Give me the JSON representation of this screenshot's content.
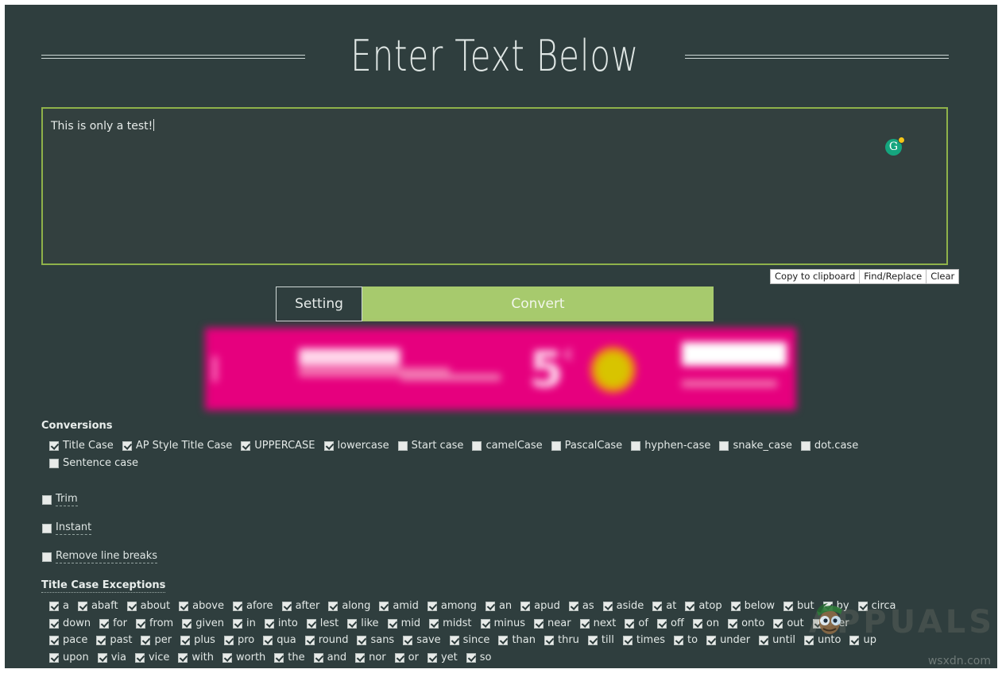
{
  "page": {
    "background_color": "#2f3e3e",
    "title": "Enter Text Below"
  },
  "editor": {
    "text": "This is only a test!",
    "grammarly_icon": "grammarly-icon",
    "grammarly_letter": "G",
    "border_color": "#8fb24a"
  },
  "editor_tools": {
    "copy_label": "Copy to clipboard",
    "find_replace_label": "Find/Replace",
    "clear_label": "Clear"
  },
  "actions": {
    "setting_label": "Setting",
    "convert_label": "Convert",
    "convert_color": "#a7ca6d"
  },
  "advert": {
    "headline_number": "5",
    "headline_sup": "€",
    "background_color": "#e6007e"
  },
  "conversions": {
    "heading": "Conversions",
    "items": [
      {
        "label": "Title Case",
        "checked": true
      },
      {
        "label": "AP Style Title Case",
        "checked": true
      },
      {
        "label": "UPPERCASE",
        "checked": true
      },
      {
        "label": "lowercase",
        "checked": true
      },
      {
        "label": "Start case",
        "checked": false
      },
      {
        "label": "camelCase",
        "checked": false
      },
      {
        "label": "PascalCase",
        "checked": false
      },
      {
        "label": "hyphen-case",
        "checked": false
      },
      {
        "label": "snake_case",
        "checked": false
      },
      {
        "label": "dot.case",
        "checked": false
      },
      {
        "label": "Sentence case",
        "checked": false
      }
    ]
  },
  "options": [
    {
      "label": "Trim",
      "checked": false
    },
    {
      "label": "Instant",
      "checked": false
    },
    {
      "label": "Remove line breaks",
      "checked": false
    }
  ],
  "exceptions": {
    "heading": "Title Case Exceptions",
    "rows": [
      [
        {
          "label": "a",
          "checked": true
        },
        {
          "label": "abaft",
          "checked": true
        },
        {
          "label": "about",
          "checked": true
        },
        {
          "label": "above",
          "checked": true
        },
        {
          "label": "afore",
          "checked": true
        },
        {
          "label": "after",
          "checked": true
        },
        {
          "label": "along",
          "checked": true
        },
        {
          "label": "amid",
          "checked": true
        },
        {
          "label": "among",
          "checked": true
        },
        {
          "label": "an",
          "checked": true
        },
        {
          "label": "apud",
          "checked": true
        },
        {
          "label": "as",
          "checked": true
        },
        {
          "label": "aside",
          "checked": true
        },
        {
          "label": "at",
          "checked": true
        },
        {
          "label": "atop",
          "checked": true
        },
        {
          "label": "below",
          "checked": true
        },
        {
          "label": "but",
          "checked": true
        },
        {
          "label": "by",
          "checked": true
        },
        {
          "label": "circa",
          "checked": true
        }
      ],
      [
        {
          "label": "down",
          "checked": true
        },
        {
          "label": "for",
          "checked": true
        },
        {
          "label": "from",
          "checked": true
        },
        {
          "label": "given",
          "checked": true
        },
        {
          "label": "in",
          "checked": true
        },
        {
          "label": "into",
          "checked": true
        },
        {
          "label": "lest",
          "checked": true
        },
        {
          "label": "like",
          "checked": true
        },
        {
          "label": "mid",
          "checked": true
        },
        {
          "label": "midst",
          "checked": true
        },
        {
          "label": "minus",
          "checked": true
        },
        {
          "label": "near",
          "checked": true
        },
        {
          "label": "next",
          "checked": true
        },
        {
          "label": "of",
          "checked": true
        },
        {
          "label": "off",
          "checked": true
        },
        {
          "label": "on",
          "checked": true
        },
        {
          "label": "onto",
          "checked": true
        },
        {
          "label": "out",
          "checked": true
        },
        {
          "label": "over",
          "checked": true
        }
      ],
      [
        {
          "label": "pace",
          "checked": true
        },
        {
          "label": "past",
          "checked": true
        },
        {
          "label": "per",
          "checked": true
        },
        {
          "label": "plus",
          "checked": true
        },
        {
          "label": "pro",
          "checked": true
        },
        {
          "label": "qua",
          "checked": true
        },
        {
          "label": "round",
          "checked": true
        },
        {
          "label": "sans",
          "checked": true
        },
        {
          "label": "save",
          "checked": true
        },
        {
          "label": "since",
          "checked": true
        },
        {
          "label": "than",
          "checked": true
        },
        {
          "label": "thru",
          "checked": true
        },
        {
          "label": "till",
          "checked": true
        },
        {
          "label": "times",
          "checked": true
        },
        {
          "label": "to",
          "checked": true
        },
        {
          "label": "under",
          "checked": true
        },
        {
          "label": "until",
          "checked": true
        },
        {
          "label": "unto",
          "checked": true
        },
        {
          "label": "up",
          "checked": true
        }
      ],
      [
        {
          "label": "upon",
          "checked": true
        },
        {
          "label": "via",
          "checked": true
        },
        {
          "label": "vice",
          "checked": true
        },
        {
          "label": "with",
          "checked": true
        },
        {
          "label": "worth",
          "checked": true
        },
        {
          "label": "the",
          "checked": true
        },
        {
          "label": "and",
          "checked": true
        },
        {
          "label": "nor",
          "checked": true
        },
        {
          "label": "or",
          "checked": true
        },
        {
          "label": "yet",
          "checked": true
        },
        {
          "label": "so",
          "checked": true
        }
      ]
    ]
  },
  "watermarks": {
    "brand": "APPUALS",
    "site": "wsxdn.com"
  }
}
